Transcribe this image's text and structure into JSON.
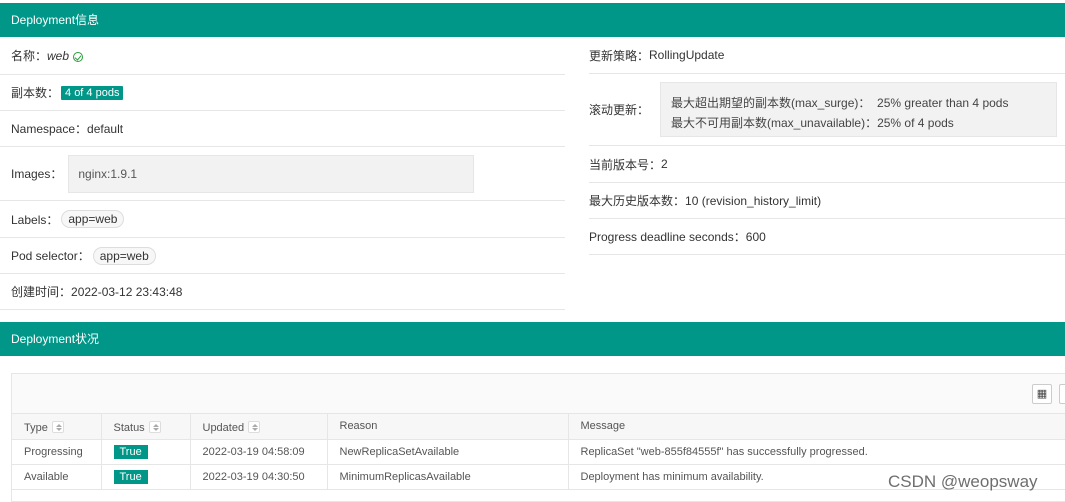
{
  "info_section": {
    "title": "Deployment信息"
  },
  "left": {
    "name_label": "名称：",
    "name_value": "web",
    "replicas_label": "副本数：",
    "replicas_value": "4 of 4 pods",
    "namespace_label": "Namespace：",
    "namespace_value": "default",
    "images_label": "Images：",
    "images_value": "nginx:1.9.1",
    "labels_label": "Labels：",
    "labels_value": "app=web",
    "selector_label": "Pod selector：",
    "selector_value": "app=web",
    "created_label": "创建时间：",
    "created_value": "2022-03-12 23:43:48"
  },
  "right": {
    "strategy_label": "更新策略：",
    "strategy_value": "RollingUpdate",
    "rolling_label": "滚动更新：",
    "max_surge": "最大超出期望的副本数(max_surge)：  25% greater than 4 pods",
    "max_unavailable": "最大不可用副本数(max_unavailable)：25% of 4 pods",
    "revision_label": "当前版本号：",
    "revision_value": "2",
    "history_label": "最大历史版本数：",
    "history_value": "10 (revision_history_limit)",
    "deadline_label": "Progress deadline seconds：",
    "deadline_value": "600"
  },
  "status_section": {
    "title": "Deployment状况"
  },
  "table": {
    "headers": [
      "Type",
      "Status",
      "Updated",
      "Reason",
      "Message"
    ],
    "rows": [
      [
        "Progressing",
        "True",
        "2022-03-19 04:58:09",
        "NewReplicaSetAvailable",
        "ReplicaSet \"web-855f84555f\" has successfully progressed."
      ],
      [
        "Available",
        "True",
        "2022-03-19 04:30:50",
        "MinimumReplicasAvailable",
        "Deployment has minimum availability."
      ]
    ]
  },
  "watermark": "CSDN @weopsway",
  "colors": {
    "accent": "#009688"
  }
}
